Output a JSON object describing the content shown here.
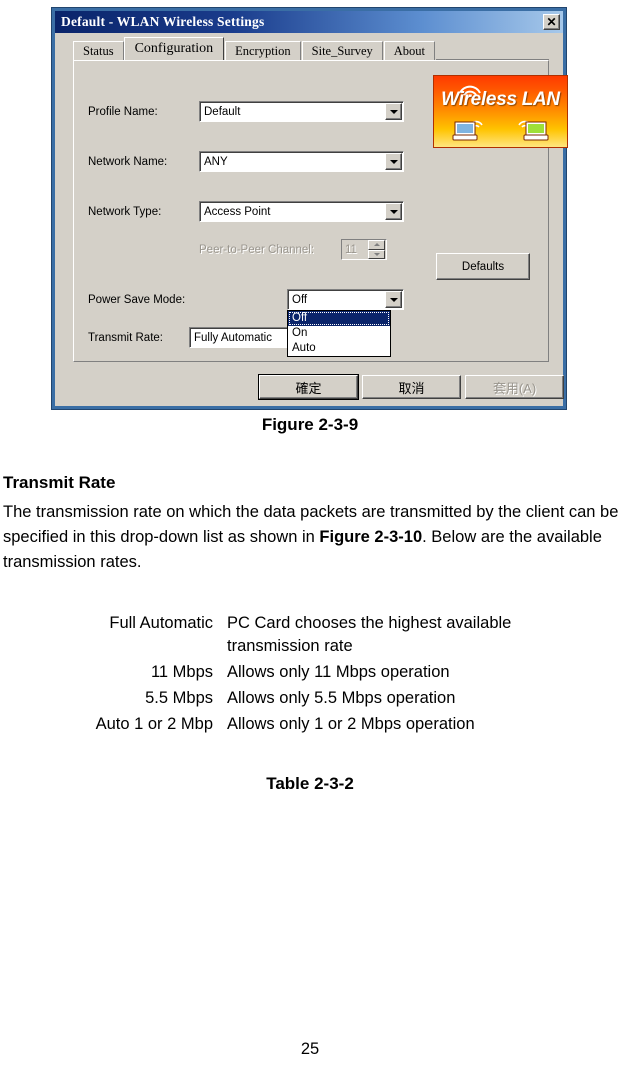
{
  "dialog": {
    "title": "Default - WLAN Wireless Settings",
    "close_label": "✕",
    "tabs": [
      {
        "label": "Status",
        "active": false
      },
      {
        "label": "Configuration",
        "active": true
      },
      {
        "label": "Encryption",
        "active": false
      },
      {
        "label": "Site_Survey",
        "active": false
      },
      {
        "label": "About",
        "active": false
      }
    ],
    "fields": {
      "profile_name_label": "Profile Name:",
      "profile_name_value": "Default",
      "network_name_label": "Network Name:",
      "network_name_value": "ANY",
      "network_type_label": "Network Type:",
      "network_type_value": "Access Point",
      "peer_channel_label": "Peer-to-Peer Channel:",
      "peer_channel_value": "11",
      "power_save_label": "Power Save Mode:",
      "power_save_value": "Off",
      "transmit_rate_label": "Transmit Rate:",
      "transmit_rate_value": "Fully Automatic"
    },
    "power_save_options": [
      {
        "label": "Off",
        "selected": true
      },
      {
        "label": "On",
        "selected": false
      },
      {
        "label": "Auto",
        "selected": false
      }
    ],
    "buttons": {
      "defaults": "Defaults",
      "ok": "確定",
      "cancel": "取消",
      "apply": "套用(A)"
    },
    "logo": {
      "text": "Wireless LAN",
      "gradient_top": "#ff3a00",
      "gradient_bottom": "#ffe680"
    },
    "colors": {
      "titlebar_start": "#0a246a",
      "titlebar_end": "#a6c8ea",
      "face": "#d4d0c8",
      "selection": "#0a246a",
      "frame": "#3a6ea5"
    }
  },
  "document": {
    "figure_caption": "Figure 2-3-9",
    "section_heading": "Transmit Rate",
    "paragraph_part1": "The transmission rate on which the data packets are transmitted by the client can be specified in this drop-down list as shown in ",
    "paragraph_bold1": "Figure 2-3-10",
    "paragraph_part2": ". Below are the available transmission rates.",
    "table_rows": [
      {
        "term": "Full Automatic",
        "desc": "PC Card chooses the highest available transmission rate"
      },
      {
        "term": "11 Mbps",
        "desc": "Allows only 11 Mbps operation"
      },
      {
        "term": "5.5 Mbps",
        "desc": "Allows only 5.5 Mbps operation"
      },
      {
        "term": "Auto 1 or 2 Mbp",
        "desc": "Allows only 1 or 2 Mbps operation"
      }
    ],
    "table_caption": "Table 2-3-2",
    "page_number": "25"
  }
}
